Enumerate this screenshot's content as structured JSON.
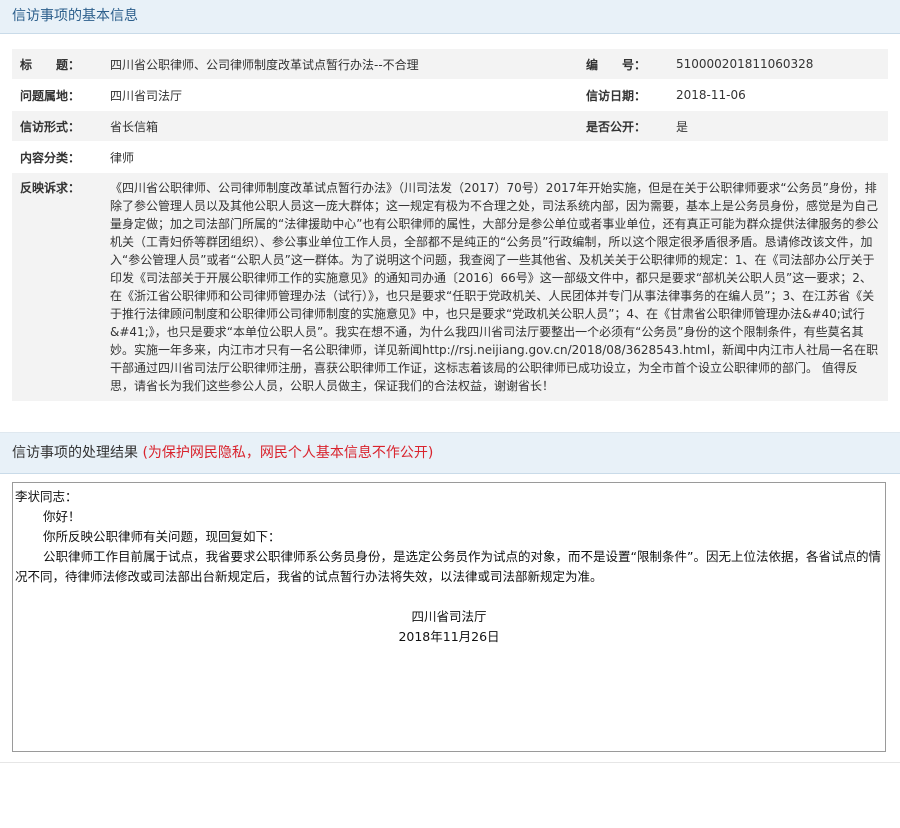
{
  "section1": {
    "title": "信访事项的基本信息"
  },
  "info": {
    "title_label": "标　　题：",
    "title_value": "四川省公职律师、公司律师制度改革试点暂行办法--不合理",
    "number_label": "编　　号：",
    "number_value": "510000201811060328",
    "place_label": "问题属地：",
    "place_value": "四川省司法厅",
    "date_label": "信访日期：",
    "date_value": "2018-11-06",
    "form_label": "信访形式：",
    "form_value": "省长信箱",
    "public_label": "是否公开：",
    "public_value": "是",
    "category_label": "内容分类：",
    "category_value": "律师",
    "appeal_label": "反映诉求：",
    "appeal_value": "《四川省公职律师、公司律师制度改革试点暂行办法》（川司法发（2017）70号）2017年开始实施，但是在关于公职律师要求“公务员”身份，排除了参公管理人员以及其他公职人员这一庞大群体；这一规定有极为不合理之处，司法系统内部，因为需要，基本上是公务员身份，感觉是为自己量身定做；加之司法部门所属的“法律援助中心”也有公职律师的属性，大部分是参公单位或者事业单位，还有真正可能为群众提供法律服务的参公机关（工青妇侨等群团组织）、参公事业单位工作人员，全部都不是纯正的“公务员”行政编制，所以这个限定很矛盾很矛盾。恳请修改该文件，加入“参公管理人员”或者“公职人员”这一群体。为了说明这个问题，我查阅了一些其他省、及机关关于公职律师的规定：1、在《司法部办公厅关于印发《司法部关于开展公职律师工作的实施意见》的通知司办通〔2016〕66号》这一部级文件中，都只是要求“部机关公职人员”这一要求；2、在《浙江省公职律师和公司律师管理办法（试行）》，也只是要求“任职于党政机关、人民团体并专门从事法律事务的在编人员”；3、在江苏省《关于推行法律顾问制度和公职律师公司律师制度的实施意见》中，也只是要求“党政机关公职人员”；4、在《甘肃省公职律师管理办法&#40;试行&#41;》，也只是要求“本单位公职人员”。我实在想不通，为什么我四川省司法厅要整出一个必须有“公务员”身份的这个限制条件，有些莫名其妙。实施一年多来，内江市才只有一名公职律师，详见新闻http://rsj.neijiang.gov.cn/2018/08/3628543.html，新闻中内江市人社局一名在职干部通过四川省司法厅公职律师注册，喜获公职律师工作证，这标志着该局的公职律师已成功设立，为全市首个设立公职律师的部门。 值得反思，请省长为我们这些参公人员，公职人员做主，保证我们的合法权益，谢谢省长！"
  },
  "section2": {
    "title": "信访事项的处理结果",
    "note": "(为保护网民隐私，网民个人基本信息不作公开)"
  },
  "reply": {
    "salutation": "李状同志：",
    "greeting": "你好！",
    "intro": "你所反映公职律师有关问题，现回复如下：",
    "body": "公职律师工作目前属于试点，我省要求公职律师系公务员身份，是选定公务员作为试点的对象，而不是设置“限制条件”。因无上位法依据，各省试点的情况不同，待律师法修改或司法部出台新规定后，我省的试点暂行办法将失效，以法律或司法部新规定为准。",
    "signature": "四川省司法厅",
    "date": "2018年11月26日"
  }
}
